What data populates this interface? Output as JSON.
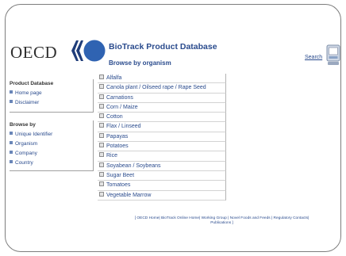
{
  "logo": {
    "text": "OECD",
    "mark_color_dark": "#1f3d7a",
    "mark_color_light": "#2f63b2"
  },
  "header": {
    "title": "BioTrack Product Database",
    "subtitle": "Browse by organism",
    "search_label": "Search"
  },
  "sidebar": {
    "product_database": {
      "heading": "Product Database",
      "items": [
        "Home page",
        "Disclaimer"
      ]
    },
    "browse_by": {
      "heading": "Browse by",
      "items": [
        "Unique Identifier",
        "Organism",
        "Company",
        "Country"
      ]
    }
  },
  "organisms": [
    "Alfalfa",
    "Canola plant / Oilseed rape / Rape Seed",
    "Carnations",
    "Corn / Maize",
    "Cotton",
    "Flax / Linseed",
    "Papayas",
    "Potatoes",
    "Rice",
    "Soyabean / Soybeans",
    "Sugar Beet",
    "Tomatoes",
    "Vegetable Marrow"
  ],
  "footer": {
    "line1": "[ OECD Home| BioTrack Online Home| Working Group | Novel Foods and Feeds | Regulatory Contacts|",
    "line2": "Publications ]"
  }
}
